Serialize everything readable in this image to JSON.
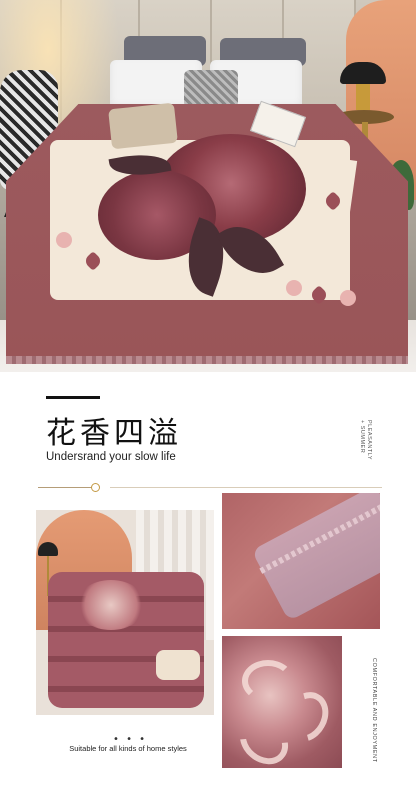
{
  "title": "花香四溢",
  "subtitle": "Undersrand your slow life",
  "side_caption": [
    "PLEASANTLY",
    "+ SUMMER"
  ],
  "detail_caption": "COMFORTABLE AND ENJOYMENT",
  "footer": {
    "dots": "• • •",
    "text": "Suitable for all kinds of home styles"
  },
  "colors": {
    "blanket": "#9a5558",
    "accent_gold": "#c49a45",
    "cream": "#f3e8d9"
  }
}
